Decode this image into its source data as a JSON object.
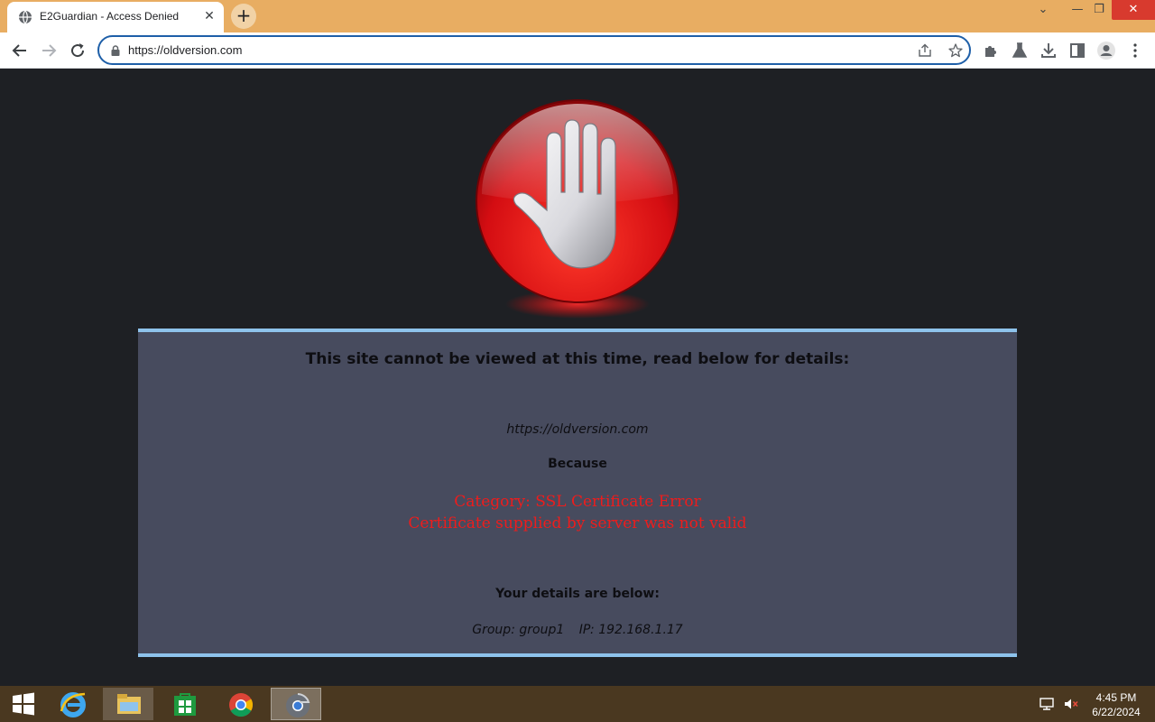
{
  "browser": {
    "tab": {
      "title": "E2Guardian - Access Denied",
      "favicon": "globe-icon",
      "close_glyph": "✕"
    },
    "new_tab_glyph": "+",
    "window_controls": {
      "dropdown": "⌄",
      "minimize": "—",
      "maximize": "❐",
      "close": "✕"
    },
    "toolbar": {
      "back": "arrow-left-icon",
      "forward": "arrow-right-icon",
      "reload": "reload-icon",
      "url": "https://oldversion.com",
      "right_icons": [
        "extensions-icon",
        "labs-icon",
        "download-icon",
        "side-panel-icon",
        "profile-icon",
        "menu-icon"
      ]
    },
    "theme_color": "#e8ad62"
  },
  "page": {
    "heading": "This site cannot be viewed at this time, read below for details:",
    "blocked_url": "https://oldversion.com",
    "because": "Because",
    "reason_category": "Category: SSL Certificate Error",
    "reason_detail": "Certificate supplied by server was not valid",
    "details_heading": "Your details are below:",
    "group": "Group: group1",
    "ip": "IP: 192.168.1.17",
    "colors": {
      "panel": "#474b5e",
      "panel_border": "#8ec3ec",
      "error_text": "#ee1c1c",
      "background": "#1e2024"
    }
  },
  "taskbar": {
    "start": "windows-start-icon",
    "apps": [
      "internet-explorer-icon",
      "file-explorer-icon",
      "store-icon",
      "chrome-icon",
      "chrome-active-icon"
    ],
    "tray": [
      "network-icon",
      "volume-muted-icon"
    ],
    "time": "4:45 PM",
    "date": "6/22/2024"
  }
}
